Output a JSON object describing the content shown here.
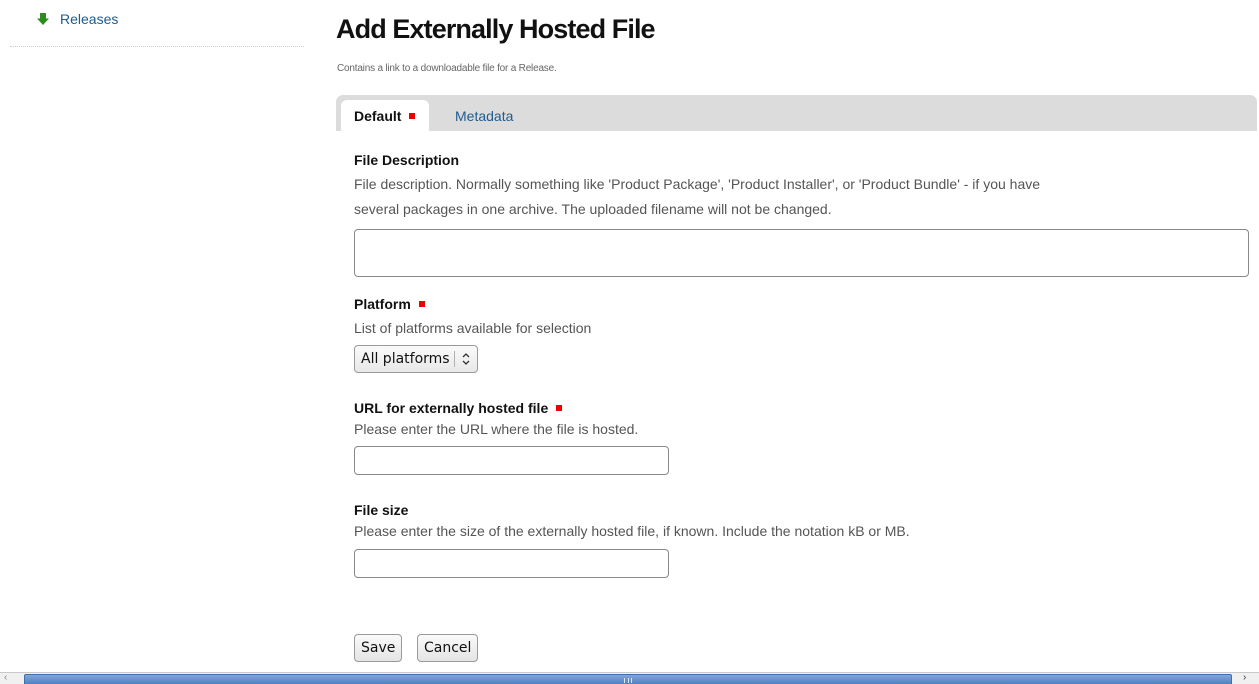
{
  "nav": {
    "releases_label": "Releases",
    "releases_icon": "green-down-arrow-icon"
  },
  "page": {
    "title": "Add Externally Hosted File",
    "description": "Contains a link to a downloadable file for a Release."
  },
  "tabs": [
    {
      "label": "Default",
      "active": true,
      "required": true
    },
    {
      "label": "Metadata",
      "active": false,
      "required": false
    }
  ],
  "fields": {
    "file_description": {
      "label": "File Description",
      "help_line1": "File description. Normally something like 'Product Package', 'Product Installer', or 'Product Bundle' - if you have",
      "help_line2": "several packages in one archive. The uploaded filename will not be changed.",
      "value": ""
    },
    "platform": {
      "label": "Platform",
      "required": true,
      "help": "List of platforms available for selection",
      "selected": "All platforms"
    },
    "url": {
      "label": "URL for externally hosted file",
      "required": true,
      "help": "Please enter the URL where the file is hosted.",
      "value": ""
    },
    "file_size": {
      "label": "File size",
      "help": "Please enter the size of the externally hosted file, if known. Include the notation kB or MB.",
      "value": ""
    }
  },
  "buttons": {
    "save": "Save",
    "cancel": "Cancel"
  },
  "colors": {
    "link": "#205c90",
    "required_marker": "#ee0000",
    "tab_bar": "#dcdcdc",
    "scroll_thumb": "#4a7cbf"
  }
}
